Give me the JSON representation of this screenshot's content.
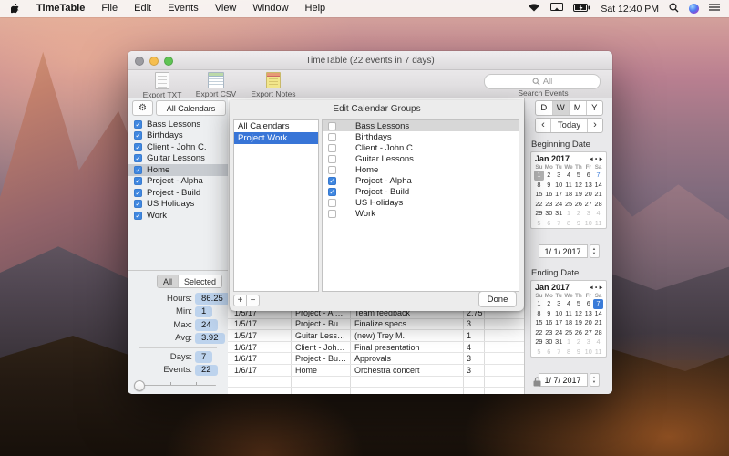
{
  "icons": {
    "check": "✓",
    "gear": "⚙",
    "cal_prev": "◂",
    "cal_dot": "•",
    "cal_next": "▸",
    "nav_prev": "‹",
    "nav_next": "›",
    "stepper_up": "▲",
    "stepper_down": "▼"
  },
  "menu_bar": {
    "app_name": "TimeTable",
    "items": [
      "File",
      "Edit",
      "Events",
      "View",
      "Window",
      "Help"
    ],
    "status": {
      "time": "Sat 12:40 PM"
    }
  },
  "window": {
    "title": "TimeTable (22 events in 7 days)",
    "toolbar": {
      "export_txt": "Export TXT",
      "export_csv": "Export CSV",
      "export_notes": "Export Notes",
      "search_placeholder": "All",
      "search_label": "Search Events"
    },
    "sidebar": {
      "dropdown": "All Calendars",
      "calendars": [
        {
          "name": "Bass Lessons",
          "checked": true,
          "selected": false
        },
        {
          "name": "Birthdays",
          "checked": true,
          "selected": false
        },
        {
          "name": "Client - John C.",
          "checked": true,
          "selected": false
        },
        {
          "name": "Guitar Lessons",
          "checked": true,
          "selected": false
        },
        {
          "name": "Home",
          "checked": true,
          "selected": true
        },
        {
          "name": "Project - Alpha",
          "checked": true,
          "selected": false
        },
        {
          "name": "Project - Build",
          "checked": true,
          "selected": false
        },
        {
          "name": "US Holidays",
          "checked": true,
          "selected": false
        },
        {
          "name": "Work",
          "checked": true,
          "selected": false
        }
      ],
      "stats": {
        "tabs": [
          {
            "label": "All",
            "active": true
          },
          {
            "label": "Selected",
            "active": false
          }
        ],
        "rows": [
          {
            "label": "Hours:",
            "value": "86.25"
          },
          {
            "label": "Min:",
            "value": "1"
          },
          {
            "label": "Max:",
            "value": "24"
          },
          {
            "label": "Avg:",
            "value": "3.92"
          },
          {
            "label": "Days:",
            "value": "7"
          },
          {
            "label": "Events:",
            "value": "22"
          }
        ],
        "divider_after_index": 3
      }
    },
    "dialog": {
      "title": "Edit Calendar Groups",
      "groups": [
        {
          "name": "All Calendars",
          "selected": false
        },
        {
          "name": "Project Work",
          "selected": true
        }
      ],
      "members": [
        {
          "name": "Bass Lessons",
          "checked": false,
          "highlighted": true
        },
        {
          "name": "Birthdays",
          "checked": false,
          "highlighted": false
        },
        {
          "name": "Client - John C.",
          "checked": false,
          "highlighted": false
        },
        {
          "name": "Guitar Lessons",
          "checked": false,
          "highlighted": false
        },
        {
          "name": "Home",
          "checked": false,
          "highlighted": false
        },
        {
          "name": "Project - Alpha",
          "checked": true,
          "highlighted": false
        },
        {
          "name": "Project - Build",
          "checked": true,
          "highlighted": false
        },
        {
          "name": "US Holidays",
          "checked": false,
          "highlighted": false
        },
        {
          "name": "Work",
          "checked": false,
          "highlighted": false
        }
      ],
      "add_label": "+",
      "remove_label": "−",
      "done_label": "Done"
    },
    "events_table": {
      "rows": [
        {
          "date": "1/5/17",
          "calendar": "Project - Al…",
          "title": "Team feedback",
          "hours": "2.75"
        },
        {
          "date": "1/5/17",
          "calendar": "Project - Bu…",
          "title": "Finalize specs",
          "hours": "3"
        },
        {
          "date": "1/5/17",
          "calendar": "Guitar Less…",
          "title": "(new) Trey M.",
          "hours": "1"
        },
        {
          "date": "1/6/17",
          "calendar": "Client - Joh…",
          "title": "Final presentation",
          "hours": "4"
        },
        {
          "date": "1/6/17",
          "calendar": "Project - Bu…",
          "title": "Approvals",
          "hours": "3"
        },
        {
          "date": "1/6/17",
          "calendar": "Home",
          "title": "Orchestra concert",
          "hours": "3"
        },
        {
          "date": "",
          "calendar": "",
          "title": "",
          "hours": ""
        },
        {
          "date": "",
          "calendar": "",
          "title": "",
          "hours": ""
        }
      ]
    },
    "right_panel": {
      "view_segments": [
        {
          "label": "D",
          "active": false
        },
        {
          "label": "W",
          "active": true
        },
        {
          "label": "M",
          "active": false
        },
        {
          "label": "Y",
          "active": false
        }
      ],
      "today_label": "Today",
      "day_headers": [
        "Su",
        "Mo",
        "Tu",
        "We",
        "Th",
        "Fr",
        "Sa"
      ],
      "weeks": [
        [
          1,
          2,
          3,
          4,
          5,
          6,
          7
        ],
        [
          8,
          9,
          10,
          11,
          12,
          13,
          14
        ],
        [
          15,
          16,
          17,
          18,
          19,
          20,
          21
        ],
        [
          22,
          23,
          24,
          25,
          26,
          27,
          28
        ],
        [
          29,
          30,
          31,
          -1,
          -2,
          -3,
          -4
        ],
        [
          -5,
          -6,
          -7,
          -8,
          -9,
          -10,
          -11
        ]
      ],
      "beginning": {
        "label": "Beginning Date",
        "month": "Jan 2017",
        "selected_day": 1,
        "selected_style": "gray",
        "today_day": 7,
        "field_value": "1/ 1/ 2017"
      },
      "ending": {
        "label": "Ending Date",
        "month": "Jan 2017",
        "selected_day": 7,
        "selected_style": "blue",
        "today_day": 7,
        "field_value": "1/ 7/ 2017",
        "locked": true
      }
    }
  },
  "colors": {
    "accent_blue": "#3a7bd8",
    "checkbox_blue": "#3f87e0",
    "stat_box_blue": "#bdd3ed"
  }
}
